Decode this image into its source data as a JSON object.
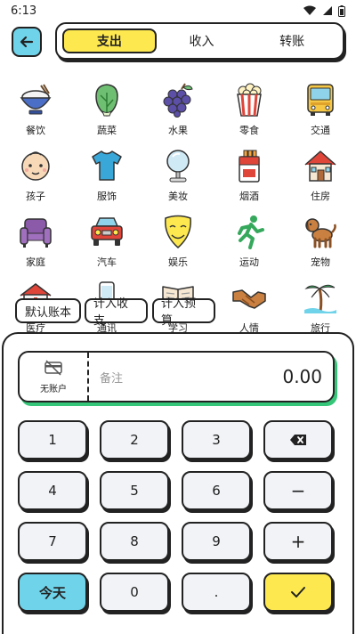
{
  "status": {
    "time": "6:13"
  },
  "tabs": [
    {
      "label": "支出"
    },
    {
      "label": "收入"
    },
    {
      "label": "转账"
    }
  ],
  "categories": [
    {
      "label": "餐饮",
      "icon": "rice-bowl-icon"
    },
    {
      "label": "蔬菜",
      "icon": "vegetable-icon"
    },
    {
      "label": "水果",
      "icon": "grapes-icon"
    },
    {
      "label": "零食",
      "icon": "popcorn-icon"
    },
    {
      "label": "交通",
      "icon": "bus-icon"
    },
    {
      "label": "孩子",
      "icon": "child-face-icon"
    },
    {
      "label": "服饰",
      "icon": "tshirt-icon"
    },
    {
      "label": "美妆",
      "icon": "mirror-icon"
    },
    {
      "label": "烟酒",
      "icon": "cigarettes-icon"
    },
    {
      "label": "住房",
      "icon": "house-icon"
    },
    {
      "label": "家庭",
      "icon": "sofa-icon"
    },
    {
      "label": "汽车",
      "icon": "car-icon"
    },
    {
      "label": "娱乐",
      "icon": "mask-icon"
    },
    {
      "label": "运动",
      "icon": "runner-icon"
    },
    {
      "label": "宠物",
      "icon": "dog-icon"
    },
    {
      "label": "医疗",
      "icon": "hospital-icon"
    },
    {
      "label": "通讯",
      "icon": "phone-icon"
    },
    {
      "label": "学习",
      "icon": "book-icon"
    },
    {
      "label": "人情",
      "icon": "handshake-icon"
    },
    {
      "label": "旅行",
      "icon": "palm-tree-icon"
    }
  ],
  "chips": {
    "default_book": "默认账本",
    "count_in_balance": "计入收支",
    "count_in_budget": "计入预算"
  },
  "input": {
    "account_label": "无账户",
    "note_placeholder": "备注",
    "amount": "0.00"
  },
  "keypad": {
    "k1": "1",
    "k2": "2",
    "k3": "3",
    "k4": "4",
    "k5": "5",
    "k6": "6",
    "k7": "7",
    "k8": "8",
    "k9": "9",
    "k0": "0",
    "dot": ".",
    "minus": "−",
    "plus": "+",
    "today": "今天",
    "backspace_icon": "backspace-icon",
    "confirm_icon": "check-icon"
  },
  "colors": {
    "accent_yellow": "#fde84f",
    "accent_blue": "#6fd3ea",
    "accent_green": "#35c679"
  }
}
